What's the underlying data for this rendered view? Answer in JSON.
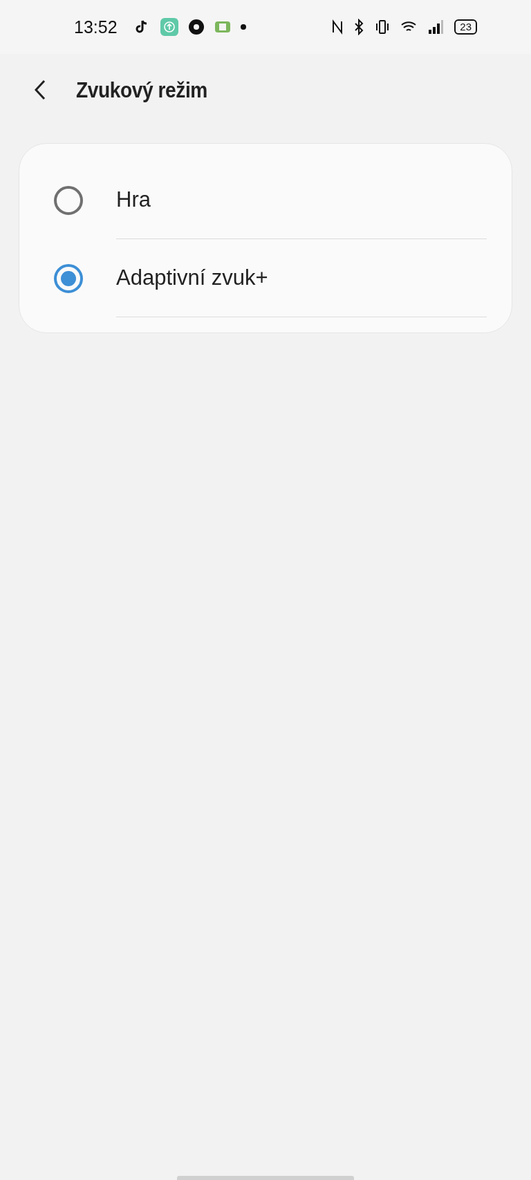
{
  "status_bar": {
    "time": "13:52",
    "battery": "23"
  },
  "header": {
    "title": "Zvukový režim"
  },
  "options": [
    {
      "label": "Hra",
      "selected": false
    },
    {
      "label": "Adaptivní zvuk+",
      "selected": true
    }
  ]
}
